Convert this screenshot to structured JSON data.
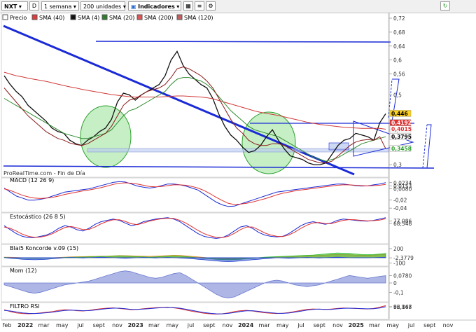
{
  "toolbar": {
    "symbol": "NXT",
    "period": "1 semana",
    "units": "200 unidades",
    "indicators_label": "Indicadores",
    "legend": [
      {
        "label": "Precio",
        "color": "#ffffff"
      },
      {
        "label": "SMA (40)",
        "color": "#e03a3a"
      },
      {
        "label": "SMA (4)",
        "color": "#111111"
      },
      {
        "label": "SMA (20)",
        "color": "#2e7d2e"
      },
      {
        "label": "SMA (200)",
        "color": "#e05555"
      },
      {
        "label": "SMA (120)",
        "color": "#c06060"
      }
    ]
  },
  "watermark": "ProRealTime.com - Fin de Día",
  "chart_data": [
    {
      "type": "line",
      "title": "",
      "series": [
        {
          "name": "Precio",
          "values": [
            0.555,
            0.53,
            0.51,
            0.495,
            0.47,
            0.455,
            0.44,
            0.425,
            0.405,
            0.395,
            0.39,
            0.37,
            0.36,
            0.355,
            0.37,
            0.38,
            0.395,
            0.405,
            0.43,
            0.48,
            0.505,
            0.5,
            0.485,
            0.5,
            0.51,
            0.52,
            0.53,
            0.555,
            0.6,
            0.625,
            0.585,
            0.56,
            0.545,
            0.53,
            0.52,
            0.49,
            0.445,
            0.41,
            0.385,
            0.37,
            0.35,
            0.335,
            0.34,
            0.355,
            0.38,
            0.4,
            0.37,
            0.345,
            0.325,
            0.32,
            0.315,
            0.305,
            0.3,
            0.3,
            0.305,
            0.33,
            0.355,
            0.37,
            0.375,
            0.39,
            0.385,
            0.38,
            0.37,
            0.42,
            0.446
          ]
        },
        {
          "name": "SMA (200)",
          "values": [
            0.565,
            0.56,
            0.555,
            0.552,
            0.548,
            0.545,
            0.542,
            0.539,
            0.535,
            0.531,
            0.527,
            0.523,
            0.52,
            0.516,
            0.513,
            0.51,
            0.507,
            0.504,
            0.501,
            0.499,
            0.497,
            0.495,
            0.494,
            0.494,
            0.494,
            0.494,
            0.494,
            0.495,
            0.496,
            0.497,
            0.497,
            0.496,
            0.495,
            0.494,
            0.492,
            0.489,
            0.484,
            0.479,
            0.474,
            0.469,
            0.464,
            0.459,
            0.454,
            0.45,
            0.447,
            0.444,
            0.441,
            0.437,
            0.433,
            0.429,
            0.425,
            0.421,
            0.418,
            0.415,
            0.413,
            0.411,
            0.409,
            0.407,
            0.406,
            0.405,
            0.404,
            0.404,
            0.404,
            0.404,
            0.4015
          ]
        },
        {
          "name": "SMA (40)",
          "values": [
            0.49,
            0.48,
            0.47,
            0.46,
            0.45,
            0.44,
            0.43,
            0.42,
            0.41,
            0.4,
            0.39,
            0.385,
            0.38,
            0.375,
            0.375,
            0.38,
            0.385,
            0.39,
            0.4,
            0.42,
            0.44,
            0.455,
            0.46,
            0.47,
            0.48,
            0.49,
            0.5,
            0.51,
            0.53,
            0.545,
            0.55,
            0.55,
            0.545,
            0.54,
            0.53,
            0.515,
            0.495,
            0.475,
            0.455,
            0.44,
            0.425,
            0.41,
            0.4,
            0.395,
            0.39,
            0.385,
            0.38,
            0.37,
            0.36,
            0.35,
            0.34,
            0.33,
            0.32,
            0.315,
            0.31,
            0.315,
            0.32,
            0.33,
            0.34,
            0.35,
            0.36,
            0.365,
            0.37,
            0.375,
            0.38
          ]
        },
        {
          "name": "SMA (20)",
          "values": [
            0.52,
            0.5,
            0.48,
            0.46,
            0.44,
            0.425,
            0.41,
            0.395,
            0.385,
            0.375,
            0.37,
            0.362,
            0.358,
            0.355,
            0.36,
            0.37,
            0.38,
            0.39,
            0.41,
            0.44,
            0.47,
            0.485,
            0.49,
            0.5,
            0.51,
            0.515,
            0.52,
            0.53,
            0.55,
            0.575,
            0.58,
            0.575,
            0.565,
            0.555,
            0.54,
            0.52,
            0.49,
            0.46,
            0.43,
            0.405,
            0.39,
            0.37,
            0.36,
            0.355,
            0.355,
            0.36,
            0.36,
            0.355,
            0.345,
            0.335,
            0.325,
            0.315,
            0.31,
            0.305,
            0.305,
            0.31,
            0.325,
            0.34,
            0.355,
            0.365,
            0.37,
            0.372,
            0.37,
            0.38,
            0.3458
          ]
        }
      ],
      "y_ticks": [
        "0,72",
        "0,68",
        "0,64",
        "0,6",
        "0,56",
        "0,5",
        "0,4",
        "0,3"
      ],
      "price_labels": [
        {
          "text": "0,446",
          "value": 0.446,
          "color": "#ffd21f",
          "fg": "#000000"
        },
        {
          "text": "0,4192",
          "value": 0.4192,
          "color": "#e03030",
          "fg": "#ffffff"
        },
        {
          "text": "0,4015",
          "value": 0.4015,
          "color": "#ffffff",
          "fg": "#e03030"
        },
        {
          "text": "0,3795",
          "value": 0.3795,
          "color": "#ffffff",
          "fg": "#000000"
        },
        {
          "text": "0,3458",
          "value": 0.3458,
          "color": "#ffffff",
          "fg": "#2e9d2e"
        }
      ],
      "ylim": [
        0.27,
        0.73
      ]
    },
    {
      "type": "line",
      "title": "MACD (12 26 9)",
      "series": [
        {
          "name": "MACD",
          "values": [
            0.01,
            0.0,
            -0.01,
            -0.015,
            -0.02,
            -0.02,
            -0.018,
            -0.015,
            -0.01,
            -0.005,
            0.0,
            0.002,
            0.004,
            0.006,
            0.008,
            0.012,
            0.016,
            0.02,
            0.024,
            0.026,
            0.025,
            0.02,
            0.015,
            0.012,
            0.01,
            0.012,
            0.016,
            0.02,
            0.02,
            0.018,
            0.015,
            0.01,
            0.005,
            -0.005,
            -0.015,
            -0.025,
            -0.032,
            -0.036,
            -0.035,
            -0.03,
            -0.025,
            -0.02,
            -0.015,
            -0.01,
            -0.005,
            0.0,
            0.002,
            0.004,
            0.006,
            0.008,
            0.01,
            0.012,
            0.014,
            0.016,
            0.018,
            0.02,
            0.02,
            0.018,
            0.016,
            0.015,
            0.0153,
            0.018,
            0.02,
            0.0234
          ]
        },
        {
          "name": "Señal",
          "values": [
            0.008,
            0.004,
            -0.002,
            -0.008,
            -0.012,
            -0.015,
            -0.016,
            -0.015,
            -0.013,
            -0.01,
            -0.006,
            -0.003,
            0.0,
            0.003,
            0.005,
            0.008,
            0.011,
            0.015,
            0.019,
            0.022,
            0.023,
            0.022,
            0.02,
            0.017,
            0.014,
            0.013,
            0.014,
            0.016,
            0.018,
            0.018,
            0.017,
            0.014,
            0.01,
            0.004,
            -0.004,
            -0.013,
            -0.021,
            -0.028,
            -0.031,
            -0.03,
            -0.028,
            -0.025,
            -0.021,
            -0.017,
            -0.012,
            -0.007,
            -0.003,
            0.0,
            0.003,
            0.005,
            0.007,
            0.009,
            0.011,
            0.013,
            0.015,
            0.017,
            0.018,
            0.018,
            0.017,
            0.016,
            0.0153,
            0.016,
            0.017,
            0.019
          ]
        }
      ],
      "y_ticks": [
        "0,0234",
        "0,0153",
        "0,0080",
        "-0,02",
        "-0,04"
      ],
      "ylim": [
        -0.045,
        0.03
      ]
    },
    {
      "type": "line",
      "title": "Estocástico (26 8 5)",
      "series": [
        {
          "name": "%K",
          "values": [
            60,
            45,
            30,
            20,
            15,
            15,
            20,
            25,
            35,
            50,
            60,
            55,
            45,
            40,
            50,
            65,
            75,
            80,
            85,
            80,
            70,
            60,
            65,
            75,
            80,
            85,
            88,
            90,
            85,
            75,
            60,
            45,
            30,
            20,
            15,
            12,
            15,
            25,
            40,
            55,
            60,
            50,
            35,
            25,
            20,
            18,
            20,
            30,
            45,
            60,
            70,
            75,
            70,
            65,
            70,
            80,
            85,
            83,
            80,
            78,
            77.08,
            80,
            85,
            90
          ]
        },
        {
          "name": "%D",
          "values": [
            55,
            50,
            40,
            28,
            20,
            16,
            17,
            22,
            30,
            42,
            53,
            57,
            52,
            45,
            46,
            55,
            67,
            76,
            82,
            82,
            76,
            67,
            64,
            70,
            77,
            82,
            86,
            88,
            87,
            80,
            70,
            56,
            42,
            30,
            22,
            16,
            15,
            20,
            31,
            45,
            55,
            55,
            45,
            33,
            25,
            20,
            19,
            25,
            36,
            50,
            62,
            70,
            72,
            68,
            68,
            74,
            80,
            83,
            82,
            80,
            78,
            79,
            81,
            86
          ]
        }
      ],
      "y_ticks": [
        "77,086",
        "68,546"
      ],
      "ylim": [
        0,
        100
      ]
    },
    {
      "type": "area",
      "title": "Blai5 Koncorde v.09 (15)",
      "series": [
        {
          "name": "Marrón",
          "values": [
            10,
            8,
            5,
            0,
            -5,
            -10,
            -8,
            -5,
            0,
            5,
            10,
            15,
            18,
            20,
            22,
            25,
            28,
            30,
            35,
            40,
            38,
            35,
            30,
            28,
            25,
            30,
            35,
            40,
            45,
            42,
            35,
            25,
            15,
            5,
            -5,
            -15,
            -20,
            -25,
            -22,
            -18,
            -10,
            -5,
            0,
            5,
            10,
            15,
            20,
            25,
            28,
            30,
            35,
            40,
            45,
            50,
            55,
            60,
            58,
            55,
            50,
            48,
            45,
            50,
            55,
            60
          ]
        },
        {
          "name": "Verde",
          "values": [
            5,
            0,
            -5,
            -8,
            -10,
            -12,
            -10,
            -8,
            -5,
            0,
            5,
            8,
            10,
            12,
            15,
            18,
            22,
            25,
            30,
            35,
            30,
            25,
            20,
            15,
            10,
            15,
            20,
            28,
            35,
            30,
            20,
            10,
            0,
            -10,
            -20,
            -30,
            -35,
            -40,
            -35,
            -30,
            -20,
            -10,
            0,
            10,
            15,
            20,
            25,
            30,
            35,
            40,
            45,
            50,
            60,
            70,
            80,
            90,
            85,
            80,
            70,
            60,
            55,
            60,
            70,
            80
          ]
        },
        {
          "name": "Azul",
          "values": [
            0,
            -10,
            -20,
            -30,
            -35,
            -40,
            -35,
            -30,
            -20,
            -10,
            0,
            5,
            0,
            -5,
            0,
            5,
            10,
            5,
            0,
            -5,
            -10,
            -5,
            0,
            5,
            0,
            -5,
            0,
            5,
            0,
            -5,
            -10,
            -20,
            -30,
            -40,
            -50,
            -60,
            -70,
            -75,
            -70,
            -60,
            -50,
            -40,
            -30,
            -20,
            -10,
            0,
            -5,
            -10,
            -5,
            0,
            5,
            0,
            -5,
            0,
            5,
            10,
            5,
            0,
            -2,
            -2.37,
            -2,
            0,
            5,
            8
          ]
        }
      ],
      "y_ticks": [
        "200",
        "-100",
        "-2,3779"
      ],
      "ylim": [
        -120,
        210
      ]
    },
    {
      "type": "area",
      "title": "Mom (12)",
      "series": [
        {
          "name": "Mom",
          "values": [
            -0.02,
            -0.04,
            -0.06,
            -0.08,
            -0.1,
            -0.11,
            -0.1,
            -0.08,
            -0.06,
            -0.04,
            -0.02,
            -0.01,
            0.0,
            0.01,
            0.02,
            0.04,
            0.06,
            0.08,
            0.1,
            0.12,
            0.13,
            0.12,
            0.1,
            0.08,
            0.06,
            0.05,
            0.06,
            0.08,
            0.1,
            0.11,
            0.08,
            0.04,
            0.0,
            -0.04,
            -0.08,
            -0.12,
            -0.15,
            -0.16,
            -0.15,
            -0.12,
            -0.09,
            -0.06,
            -0.03,
            0.0,
            0.02,
            0.03,
            0.02,
            0.0,
            -0.02,
            -0.03,
            -0.04,
            -0.03,
            -0.02,
            0.0,
            0.02,
            0.04,
            0.06,
            0.08,
            0.07,
            0.06,
            0.05,
            0.06,
            0.07,
            0.078
          ]
        }
      ],
      "y_ticks": [
        "0,0780",
        "0",
        "-0,1"
      ],
      "ylim": [
        -0.18,
        0.15
      ]
    },
    {
      "type": "line",
      "title": "FILTRO RSI",
      "series": [
        {
          "name": "RSI",
          "values": [
            60,
            45,
            35,
            30,
            28,
            30,
            35,
            40,
            45,
            55,
            60,
            58,
            52,
            50,
            55,
            62,
            68,
            72,
            75,
            70,
            65,
            60,
            62,
            68,
            72,
            76,
            78,
            80,
            75,
            68,
            58,
            48,
            40,
            32,
            28,
            25,
            28,
            35,
            45,
            52,
            55,
            50,
            42,
            36,
            32,
            30,
            32,
            38,
            46,
            55,
            62,
            66,
            64,
            62,
            65,
            70,
            74,
            72,
            70,
            68,
            66,
            70,
            80,
            92.167
          ]
        },
        {
          "name": "Media",
          "values": [
            55,
            50,
            42,
            35,
            31,
            30,
            32,
            36,
            41,
            48,
            54,
            57,
            55,
            52,
            53,
            58,
            64,
            69,
            72,
            72,
            68,
            63,
            62,
            65,
            69,
            73,
            76,
            78,
            77,
            72,
            64,
            55,
            46,
            38,
            32,
            28,
            27,
            31,
            38,
            46,
            51,
            52,
            47,
            41,
            36,
            32,
            31,
            34,
            41,
            49,
            57,
            63,
            65,
            63,
            63,
            67,
            71,
            72,
            71,
            69,
            67,
            68,
            74,
            84
          ]
        }
      ],
      "y_ticks": [
        "92,167",
        "86,848"
      ],
      "ylim": [
        0,
        100
      ]
    }
  ],
  "x_axis": {
    "labels": [
      "feb",
      "2022",
      "mar",
      "may",
      "jul",
      "sept",
      "nov",
      "2023",
      "mar",
      "may",
      "jul",
      "sept",
      "nov",
      "2024",
      "mar",
      "may",
      "jul",
      "sept",
      "nov",
      "2025",
      "mar",
      "may",
      "jul",
      "sept",
      "nov"
    ]
  }
}
